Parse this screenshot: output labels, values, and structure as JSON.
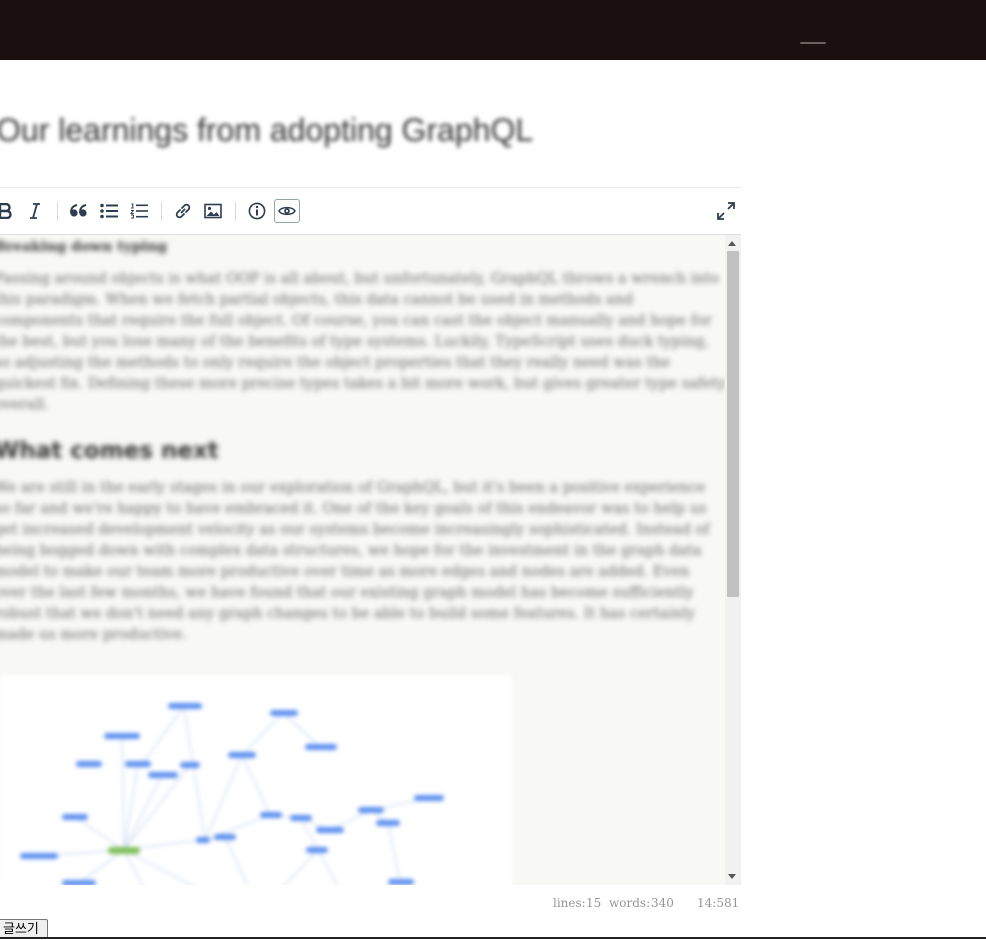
{
  "header": {},
  "post": {
    "title": "Our learnings from adopting GraphQL"
  },
  "toolbar": {
    "buttons": [
      {
        "name": "bold",
        "icon": "bold-icon"
      },
      {
        "name": "italic",
        "icon": "italic-icon"
      },
      {
        "name": "quote",
        "icon": "quote-icon"
      },
      {
        "name": "unordered-list",
        "icon": "unordered-list-icon"
      },
      {
        "name": "ordered-list",
        "icon": "ordered-list-icon"
      },
      {
        "name": "link",
        "icon": "link-icon"
      },
      {
        "name": "image",
        "icon": "image-icon"
      },
      {
        "name": "guide",
        "icon": "info-icon"
      },
      {
        "name": "preview",
        "icon": "eye-icon",
        "active": true
      },
      {
        "name": "fullscreen",
        "icon": "fullscreen-icon"
      }
    ]
  },
  "editor": {
    "heading1": "Breaking down typing",
    "para1": "Passing around objects is what OOP is all about, but unfortunately, GraphQL throws a wrench into this paradigm. When we fetch partial objects, this data cannot be used in methods and components that require the full object. Of course, you can cast the object manually and hope for the best, but you lose many of the benefits of type systems. Luckily, TypeScript uses duck typing, so adjusting the methods to only require the object properties that they really need was the quickest fix. Defining these more precise types takes a bit more work, but gives greater type safety overall.",
    "heading2": "What comes next",
    "para2": "We are still in the early stages in our exploration of GraphQL, but it's been a positive experience so far and we're happy to have embraced it. One of the key goals of this endeavor was to help us get increased development velocity as our systems become increasingly sophisticated. Instead of being bogged down with complex data structures, we hope for the investment in the graph data model to make our team more productive over time as more edges and nodes are added. Even over the last few months, we have found that our existing graph model has become sufficiently robust that we don't need any graph changes to be able to build some features. It has certainly made us more productive."
  },
  "status": {
    "lines_label": "lines:",
    "lines_value": "15",
    "words_label": "words:",
    "words_value": "340",
    "cursor": "14:581"
  },
  "actions": {
    "write_label": "글쓰기"
  },
  "colors": {
    "topbar": "#1b100f",
    "editor_bg": "#f8f8f5",
    "graph_node": "#5b8ff0",
    "graph_node_highlight": "#7fbf5a",
    "graph_edge": "#c9d8f3"
  }
}
